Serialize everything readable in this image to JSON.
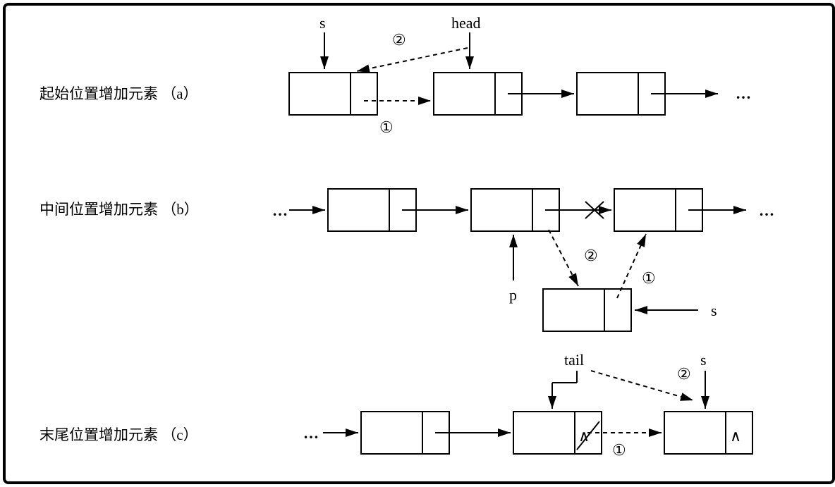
{
  "labels": {
    "s": "s",
    "head": "head",
    "p": "p",
    "tail": "tail",
    "one": "①",
    "two": "②",
    "ellipsis": "…"
  },
  "captions": {
    "a": "起始位置增加元素 （a）",
    "b": "中间位置增加元素 （b）",
    "c": "末尾位置增加元素 （c）"
  }
}
